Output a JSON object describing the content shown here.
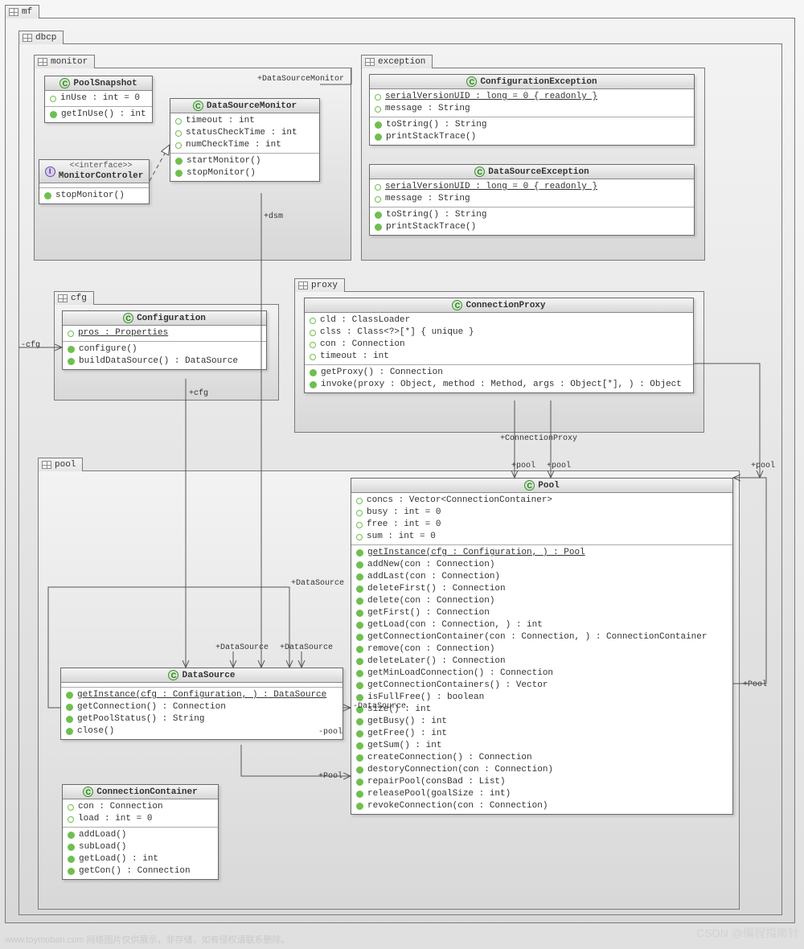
{
  "watermarks": {
    "left": "www.toymoban.com 网络图片仅供展示，非存储，如有侵权请联系删除。",
    "right": "CSDN @编程指南针"
  },
  "packages": {
    "mf": "mf",
    "dbcp": "dbcp",
    "monitor": "monitor",
    "exception": "exception",
    "cfg": "cfg",
    "proxy": "proxy",
    "pool": "pool"
  },
  "labels": {
    "dsm_top": "+DataSourceMonitor",
    "dsm": "+dsm",
    "cfg_left": "-cfg",
    "cfg_below": "+cfg",
    "connProxy": "+ConnectionProxy",
    "pool_r1": "+pool",
    "pool_r2": "+pool",
    "pool_r3": "+pool",
    "pool_right": "+Pool",
    "ds_lab1": "+DataSource",
    "ds_lab2": "+DataSource",
    "ds_lab3": "+DataSource",
    "neg_ds": "-DataSource",
    "neg_pool": "-pool",
    "plus_pool_b": "+Pool",
    "gcc": "getConnectionContainers()",
    "iff": "isFullFree()"
  },
  "classes": {
    "PoolSnapshot": {
      "name": "PoolSnapshot",
      "attrs": [
        {
          "v": "priv",
          "txt": "inUse : int = 0"
        }
      ],
      "ops": [
        {
          "v": "pub",
          "txt": "getInUse() : int"
        }
      ]
    },
    "DataSourceMonitor": {
      "name": "DataSourceMonitor",
      "attrs": [
        {
          "v": "priv",
          "txt": "timeout : int"
        },
        {
          "v": "priv",
          "txt": "statusCheckTime : int"
        },
        {
          "v": "priv",
          "txt": "numCheckTime : int"
        }
      ],
      "ops": [
        {
          "v": "pub",
          "txt": "startMonitor()"
        },
        {
          "v": "pub",
          "txt": "stopMonitor()"
        }
      ]
    },
    "MonitorControler": {
      "stereo": "<<interface>>",
      "name": "MonitorControler",
      "ops": [
        {
          "v": "pub",
          "txt": "stopMonitor()"
        }
      ]
    },
    "ConfigurationException": {
      "name": "ConfigurationException",
      "attrs": [
        {
          "v": "priv",
          "txt": "serialVersionUID : long = 0 { readonly }",
          "under": true
        },
        {
          "v": "priv",
          "txt": "message : String"
        }
      ],
      "ops": [
        {
          "v": "pub",
          "txt": "toString() : String"
        },
        {
          "v": "pub",
          "txt": "printStackTrace()"
        }
      ]
    },
    "DataSourceException": {
      "name": "DataSourceException",
      "attrs": [
        {
          "v": "priv",
          "txt": "serialVersionUID : long = 0 { readonly }",
          "under": true
        },
        {
          "v": "priv",
          "txt": "message : String"
        }
      ],
      "ops": [
        {
          "v": "pub",
          "txt": "toString() : String"
        },
        {
          "v": "pub",
          "txt": "printStackTrace()"
        }
      ]
    },
    "Configuration": {
      "name": "Configuration",
      "attrs": [
        {
          "v": "priv",
          "txt": "pros : Properties",
          "under": true
        }
      ],
      "ops": [
        {
          "v": "pub",
          "txt": "configure()"
        },
        {
          "v": "pub",
          "txt": "buildDataSource() : DataSource"
        }
      ]
    },
    "ConnectionProxy": {
      "name": "ConnectionProxy",
      "attrs": [
        {
          "v": "priv",
          "txt": "cld : ClassLoader"
        },
        {
          "v": "priv",
          "txt": "clss : Class<?>[*] { unique }"
        },
        {
          "v": "priv",
          "txt": "con : Connection"
        },
        {
          "v": "priv",
          "txt": "timeout : int"
        }
      ],
      "ops": [
        {
          "v": "pub",
          "txt": "getProxy() : Connection"
        },
        {
          "v": "pub",
          "txt": "invoke(proxy : Object, method : Method, args : Object[*], ) : Object"
        }
      ]
    },
    "DataSource": {
      "name": "DataSource",
      "ops": [
        {
          "v": "pub",
          "txt": "getInstance(cfg : Configuration, ) : DataSource",
          "under": true
        },
        {
          "v": "pub",
          "txt": "getConnection() : Connection"
        },
        {
          "v": "pub",
          "txt": "getPoolStatus() : String"
        },
        {
          "v": "pub",
          "txt": "close()"
        }
      ]
    },
    "ConnectionContainer": {
      "name": "ConnectionContainer",
      "attrs": [
        {
          "v": "priv",
          "txt": "con : Connection"
        },
        {
          "v": "priv",
          "txt": "load : int = 0"
        }
      ],
      "ops": [
        {
          "v": "pub",
          "txt": "addLoad()"
        },
        {
          "v": "pub",
          "txt": "subLoad()"
        },
        {
          "v": "pub",
          "txt": "getLoad() : int"
        },
        {
          "v": "pub",
          "txt": "getCon() : Connection"
        }
      ]
    },
    "Pool": {
      "name": "Pool",
      "attrs": [
        {
          "v": "priv",
          "txt": "concs : Vector<ConnectionContainer>"
        },
        {
          "v": "priv",
          "txt": "busy : int = 0"
        },
        {
          "v": "priv",
          "txt": "free : int = 0"
        },
        {
          "v": "priv",
          "txt": "sum : int = 0"
        }
      ],
      "ops": [
        {
          "v": "pub",
          "txt": "getInstance(cfg : Configuration, ) : Pool",
          "under": true
        },
        {
          "v": "pub",
          "txt": "addNew(con : Connection)"
        },
        {
          "v": "pub",
          "txt": "addLast(con : Connection)"
        },
        {
          "v": "pub",
          "txt": "deleteFirst() : Connection"
        },
        {
          "v": "pub",
          "txt": "delete(con : Connection)"
        },
        {
          "v": "pub",
          "txt": "getFirst() : Connection"
        },
        {
          "v": "pub",
          "txt": "getLoad(con : Connection, ) : int"
        },
        {
          "v": "pub",
          "txt": "getConnectionContainer(con : Connection, ) : ConnectionContainer"
        },
        {
          "v": "pub",
          "txt": "remove(con : Connection)"
        },
        {
          "v": "pub",
          "txt": "deleteLater() : Connection"
        },
        {
          "v": "pub",
          "txt": "getMinLoadConnection() : Connection"
        },
        {
          "v": "pub",
          "txt": "getConnectionContainers() : Vector"
        },
        {
          "v": "pub",
          "txt": "isFullFree() : boolean"
        },
        {
          "v": "pub",
          "txt": "size() : int"
        },
        {
          "v": "pub",
          "txt": "getBusy() : int"
        },
        {
          "v": "pub",
          "txt": "getFree() : int"
        },
        {
          "v": "pub",
          "txt": "getSum() : int"
        },
        {
          "v": "pub",
          "txt": "createConnection() : Connection"
        },
        {
          "v": "pub",
          "txt": "destoryConnection(con : Connection)"
        },
        {
          "v": "pub",
          "txt": "repairPool(consBad : List)"
        },
        {
          "v": "pub",
          "txt": "releasePool(goalSize : int)"
        },
        {
          "v": "pub",
          "txt": "revokeConnection(con : Connection)"
        }
      ]
    }
  }
}
